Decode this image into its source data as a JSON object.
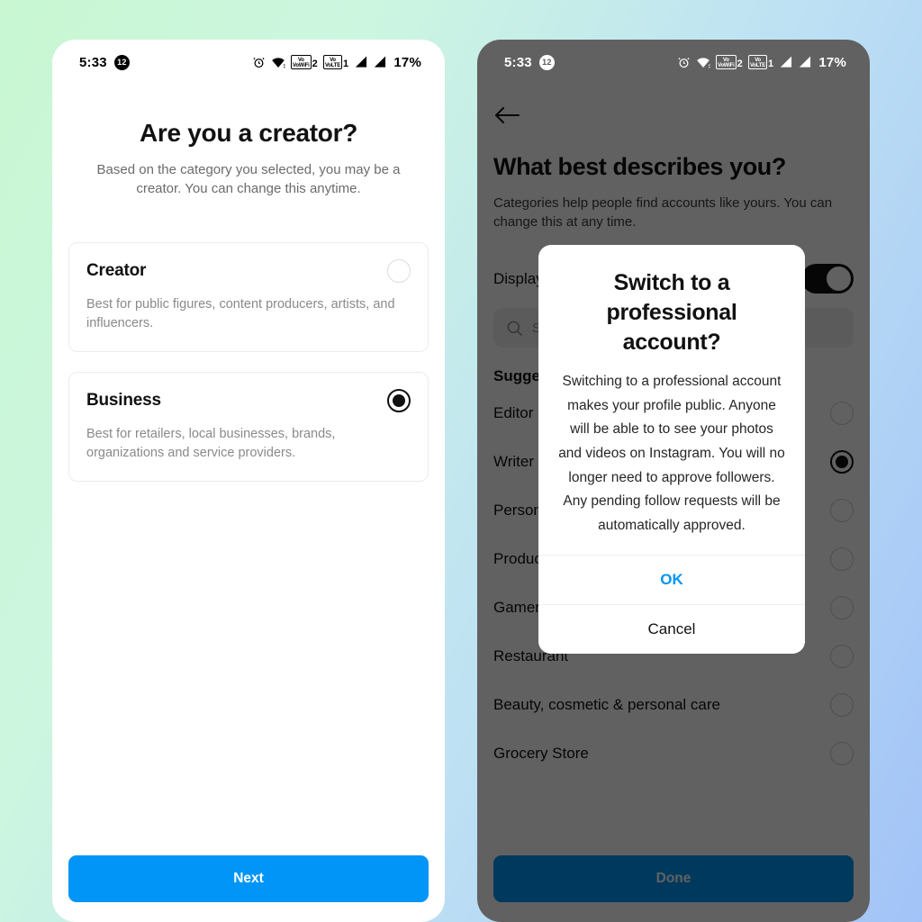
{
  "status_bar": {
    "time": "5:33",
    "notification_count": "12",
    "alarm_icon": "alarm-icon",
    "wifi_icon": "wifi-icon",
    "vowifi_label": "VoWiFi",
    "vowifi_sim": "2",
    "volte_label": "VoLTE",
    "volte_sim": "1",
    "signal_icon": "signal-bars-icon",
    "battery": "17%"
  },
  "left_screen": {
    "title": "Are you a creator?",
    "subtitle": "Based on the category you selected, you may be a creator. You can change this anytime.",
    "options": [
      {
        "name": "Creator",
        "description": "Best for public figures, content producers, artists, and influencers.",
        "selected": false
      },
      {
        "name": "Business",
        "description": "Best for retailers, local businesses, brands, organizations and service providers.",
        "selected": true
      }
    ],
    "cta_label": "Next"
  },
  "right_screen": {
    "back_icon": "back-arrow-icon",
    "title": "What best describes you?",
    "subtitle": "Categories help people find accounts like yours. You can change this at any time.",
    "display_row_label": "Display category on profile",
    "toggle_state": "on",
    "search_icon": "search-icon",
    "search_placeholder": "Search",
    "section_header": "Suggested",
    "categories": [
      {
        "label": "Editor",
        "selected": false
      },
      {
        "label": "Writer",
        "selected": true
      },
      {
        "label": "Personal blog",
        "selected": false
      },
      {
        "label": "Product/service",
        "selected": false
      },
      {
        "label": "Gamer",
        "selected": false
      },
      {
        "label": "Restaurant",
        "selected": false
      },
      {
        "label": "Beauty, cosmetic & personal care",
        "selected": false
      },
      {
        "label": "Grocery Store",
        "selected": false
      }
    ],
    "cta_label": "Done"
  },
  "dialog": {
    "title": "Switch to a professional account?",
    "message": "Switching to a professional account makes your profile public. Anyone will be able to to see your photos and videos on Instagram. You will no longer need to approve followers. Any pending follow requests will be automatically approved.",
    "ok_label": "OK",
    "cancel_label": "Cancel"
  },
  "colors": {
    "accent_blue": "#0095f6",
    "background_gradient_start": "#c8f7d2",
    "background_gradient_end": "#a2c3f7",
    "scrim": "rgba(0,0,0,0.62)"
  }
}
